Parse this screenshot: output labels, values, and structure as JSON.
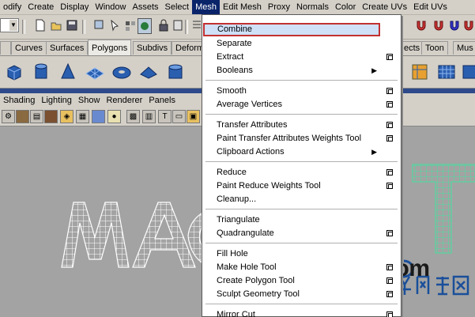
{
  "menubar": {
    "items": [
      "odify",
      "Create",
      "Display",
      "Window",
      "Assets",
      "Select",
      "Mesh",
      "Edit Mesh",
      "Proxy",
      "Normals",
      "Color",
      "Create UVs",
      "Edit UVs"
    ],
    "active": "Mesh"
  },
  "shelf_tabs": {
    "left": [
      "Curves",
      "Surfaces",
      "Polygons",
      "Subdivs",
      "Deform"
    ],
    "right": [
      "ects",
      "Toon",
      "Mus"
    ],
    "active": "Polygons"
  },
  "panel_menu": [
    "Shading",
    "Lighting",
    "Show",
    "Renderer",
    "Panels"
  ],
  "mesh_menu": {
    "items": [
      {
        "label": "Combine",
        "highlighted": true
      },
      {
        "label": "Separate"
      },
      {
        "label": "Extract",
        "option_box": true
      },
      {
        "label": "Booleans",
        "submenu": true
      },
      {
        "label": "Smooth",
        "option_box": true
      },
      {
        "label": "Average Vertices",
        "option_box": true
      },
      {
        "label": "Transfer Attributes",
        "option_box": true
      },
      {
        "label": "Paint Transfer Attributes Weights Tool",
        "option_box": true
      },
      {
        "label": "Clipboard Actions",
        "submenu": true
      },
      {
        "label": "Reduce",
        "option_box": true
      },
      {
        "label": "Paint Reduce Weights Tool",
        "option_box": true
      },
      {
        "label": "Cleanup...",
        "option_box": false
      },
      {
        "label": "Triangulate"
      },
      {
        "label": "Quadrangulate",
        "option_box": true
      },
      {
        "label": "Fill Hole"
      },
      {
        "label": "Make Hole Tool",
        "option_box": true
      },
      {
        "label": "Create Polygon Tool",
        "option_box": true
      },
      {
        "label": "Sculpt Geometry Tool",
        "option_box": true
      },
      {
        "label": "Mirror Cut",
        "option_box": true
      }
    ]
  },
  "viewport": {
    "letters": [
      "M",
      "A",
      "C",
      "T"
    ]
  },
  "watermark": {
    "text": "fevte.com"
  },
  "colors": {
    "menu_highlight_bg": "#0a246a",
    "selection_border": "#c23030",
    "viewport_bg": "#a3a3a3",
    "wire_white": "#ffffff",
    "wire_green": "#55d6a0",
    "blue_band": "#2e4a8a"
  }
}
